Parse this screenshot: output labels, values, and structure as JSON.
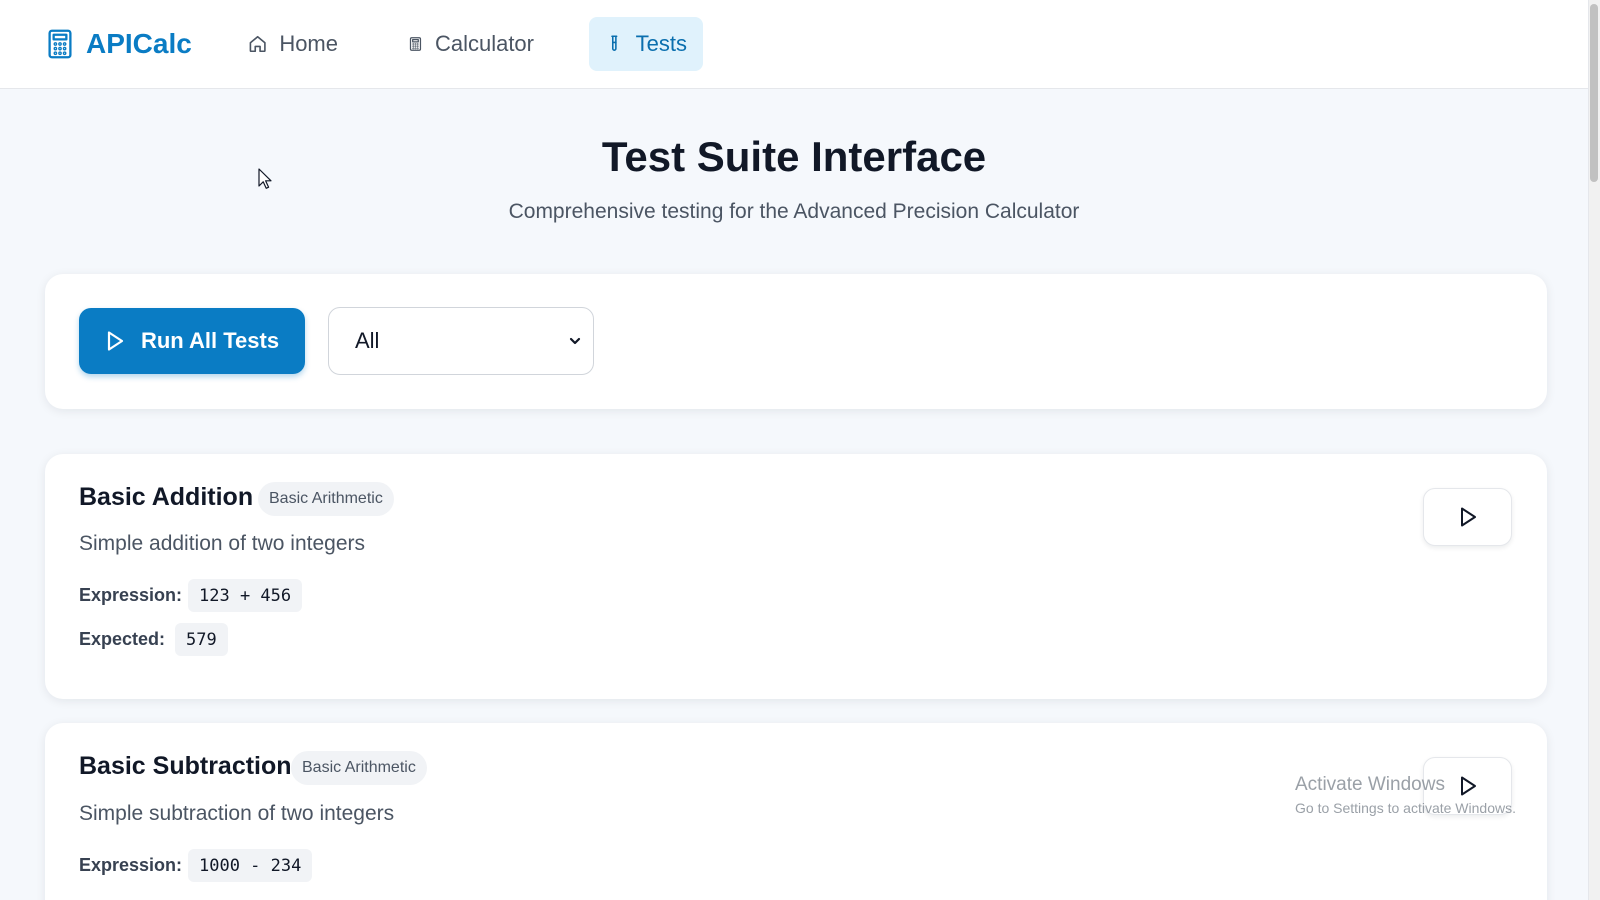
{
  "nav": {
    "brand": "APICalc",
    "brand_icon": "calculator-icon",
    "items": [
      {
        "label": "Home",
        "icon": "home-icon",
        "active": false
      },
      {
        "label": "Calculator",
        "icon": "calculator-icon",
        "active": false
      },
      {
        "label": "Tests",
        "icon": "test-tube-icon",
        "active": true
      }
    ]
  },
  "header": {
    "title": "Test Suite Interface",
    "subtitle": "Comprehensive testing for the Advanced Precision Calculator"
  },
  "controls": {
    "run_all_label": "Run All Tests",
    "filter_value": "All"
  },
  "tests": [
    {
      "title": "Basic Addition",
      "category": "Basic Arithmetic",
      "description": "Simple addition of two integers",
      "expression_label": "Expression:",
      "expression": "123 + 456",
      "expected_label": "Expected:",
      "expected": "579"
    },
    {
      "title": "Basic Subtraction",
      "category": "Basic Arithmetic",
      "description": "Simple subtraction of two integers",
      "expression_label": "Expression:",
      "expression": "1000 - 234"
    }
  ],
  "watermark": {
    "title": "Activate Windows",
    "subtitle": "Go to Settings to activate Windows."
  },
  "colors": {
    "accent": "#0a7cc4",
    "active_nav_bg": "#e0f2fc",
    "page_bg": "#f5f8fc"
  }
}
